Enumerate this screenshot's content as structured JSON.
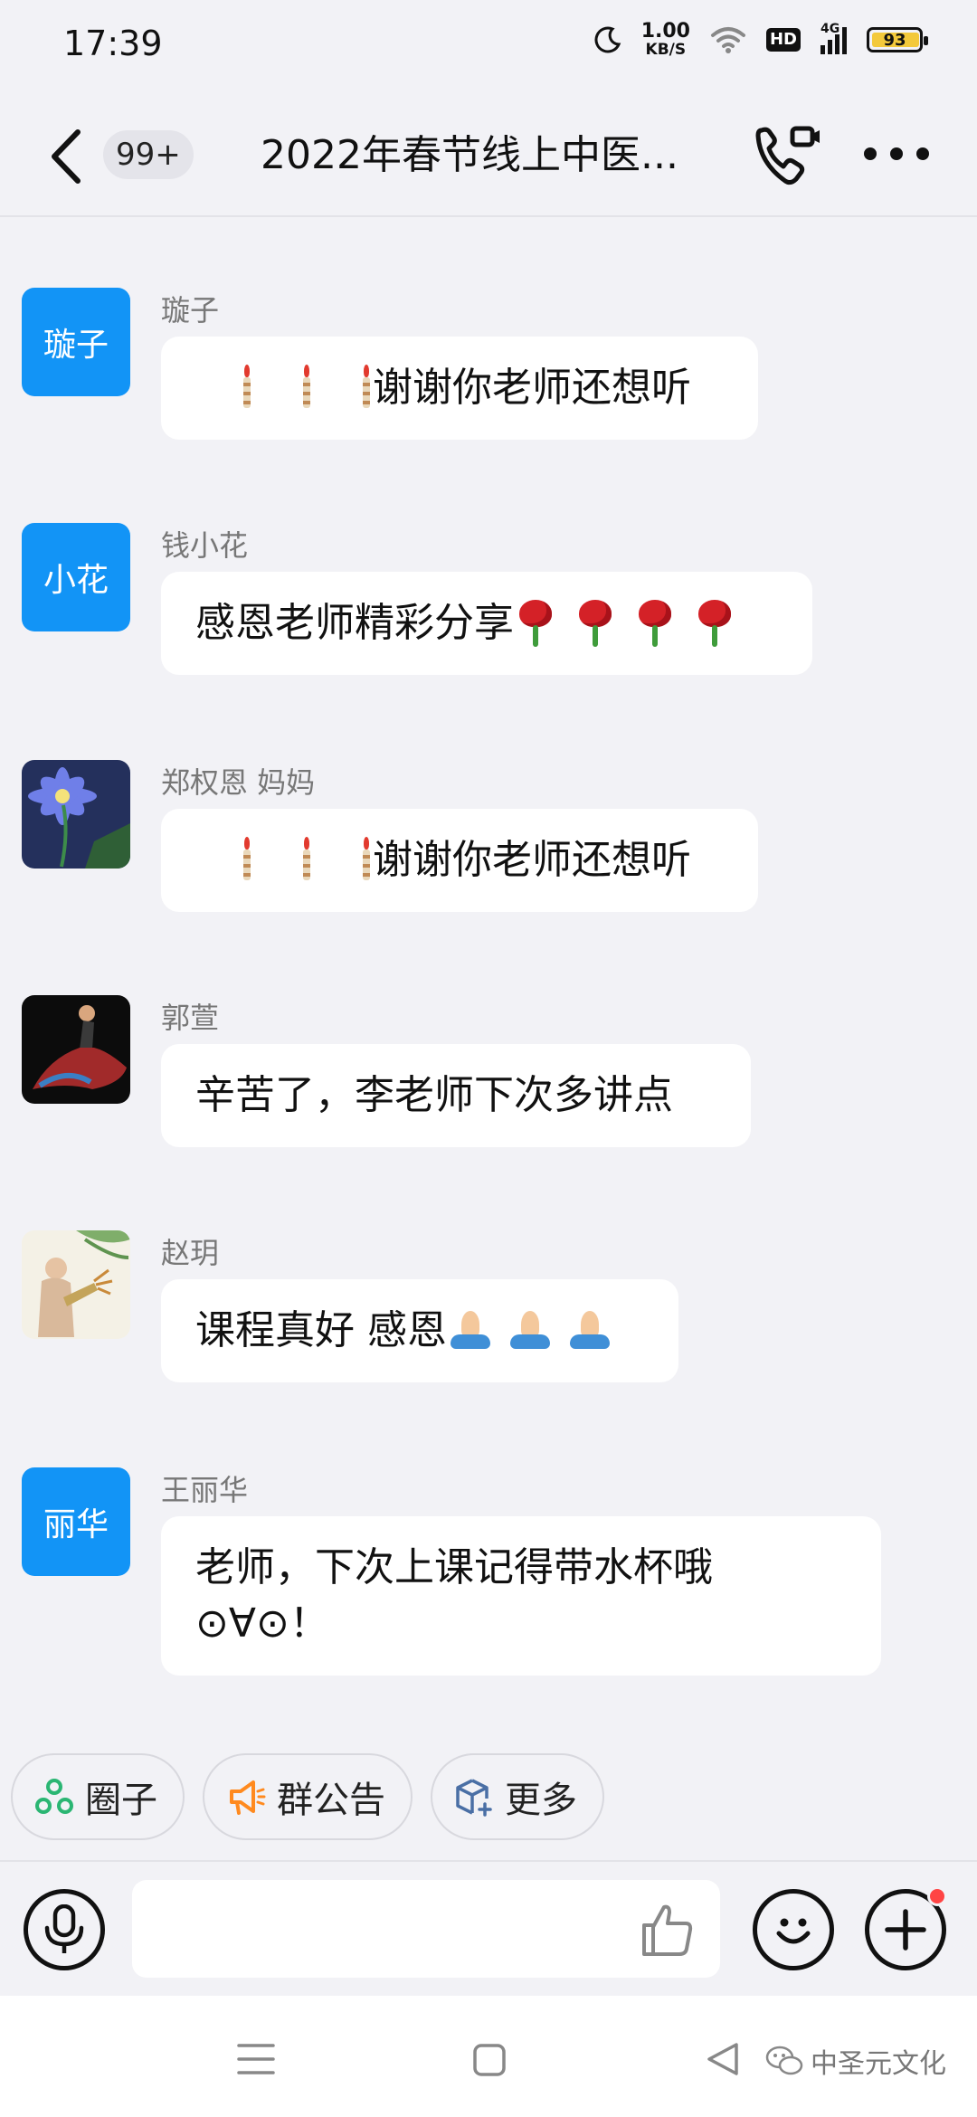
{
  "status_bar": {
    "time": "17:39",
    "speed_value": "1.00",
    "speed_unit": "KB/S",
    "hd": "HD",
    "network": "4G",
    "battery": "93"
  },
  "header": {
    "unread_badge": "99+",
    "title": "2022年春节线上中医..."
  },
  "messages": [
    {
      "sender": "璇子",
      "avatar_text": "璇子",
      "text": "谢谢你老师还想听"
    },
    {
      "sender": "钱小花",
      "avatar_text": "小花",
      "text": "感恩老师精彩分享"
    },
    {
      "sender": "郑权恩  妈妈",
      "text": "谢谢你老师还想听"
    },
    {
      "sender": "郭萱",
      "text": "辛苦了，李老师下次多讲点"
    },
    {
      "sender": "赵玥",
      "text": "课程真好 感恩"
    },
    {
      "sender": "王丽华",
      "avatar_text": "丽华",
      "text_line1": "老师，下次上课记得带水杯哦",
      "text_line2": "⊙∀⊙！"
    }
  ],
  "quick_chips": [
    {
      "label": "圈子",
      "icon": "circle-group-icon"
    },
    {
      "label": "群公告",
      "icon": "megaphone-icon"
    },
    {
      "label": "更多",
      "icon": "cube-plus-icon"
    }
  ],
  "watermark": "中圣元文化",
  "colors": {
    "accent_blue": "#1294f6",
    "background": "#f2f2f6",
    "bubble": "#ffffff",
    "chip_green": "#2bb673",
    "chip_orange": "#ff8a1f",
    "notification_red": "#ff4444"
  }
}
